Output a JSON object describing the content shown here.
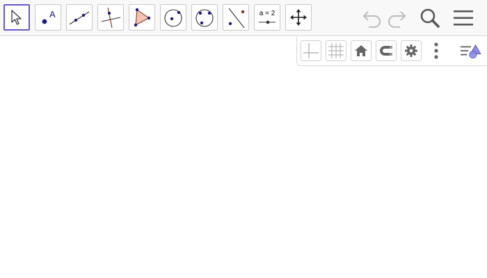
{
  "toolbar": {
    "tools": [
      {
        "name": "move-tool",
        "icon": "arrow-cursor-icon",
        "selected": true
      },
      {
        "name": "point-tool",
        "icon": "point-icon",
        "label": "A"
      },
      {
        "name": "line-tool",
        "icon": "line-through-points-icon"
      },
      {
        "name": "perpendicular-line-tool",
        "icon": "perpendicular-line-icon"
      },
      {
        "name": "polygon-tool",
        "icon": "polygon-icon"
      },
      {
        "name": "circle-center-point-tool",
        "icon": "circle-center-icon"
      },
      {
        "name": "circle-three-points-tool",
        "icon": "circle-three-points-icon"
      },
      {
        "name": "reflect-about-line-tool",
        "icon": "reflect-icon"
      },
      {
        "name": "slider-tool",
        "icon": "slider-icon",
        "label": "a = 2"
      },
      {
        "name": "move-graphics-view-tool",
        "icon": "move-arrows-icon"
      }
    ],
    "undo_icon": "undo-icon",
    "redo_icon": "redo-icon",
    "search_icon": "search-icon",
    "menu_icon": "hamburger-menu-icon"
  },
  "graphics_style_bar": {
    "buttons": [
      {
        "name": "axes-toggle",
        "icon": "axes-icon"
      },
      {
        "name": "grid-toggle",
        "icon": "grid-icon"
      },
      {
        "name": "standard-view",
        "icon": "home-icon"
      },
      {
        "name": "point-capturing",
        "icon": "magnet-icon"
      },
      {
        "name": "graphics-settings",
        "icon": "gear-icon"
      },
      {
        "name": "more-options",
        "icon": "vertical-dots-icon"
      },
      {
        "name": "toggle-style-bar",
        "icon": "style-bar-icon"
      }
    ]
  },
  "colors": {
    "selected_border": "#6557d2",
    "point_blue": "#1a1a8c",
    "point_red": "#8b2b12",
    "polygon_fill": "#f3c3b4",
    "disabled_gray": "#c0c0c0",
    "icon_dark": "#555555"
  }
}
